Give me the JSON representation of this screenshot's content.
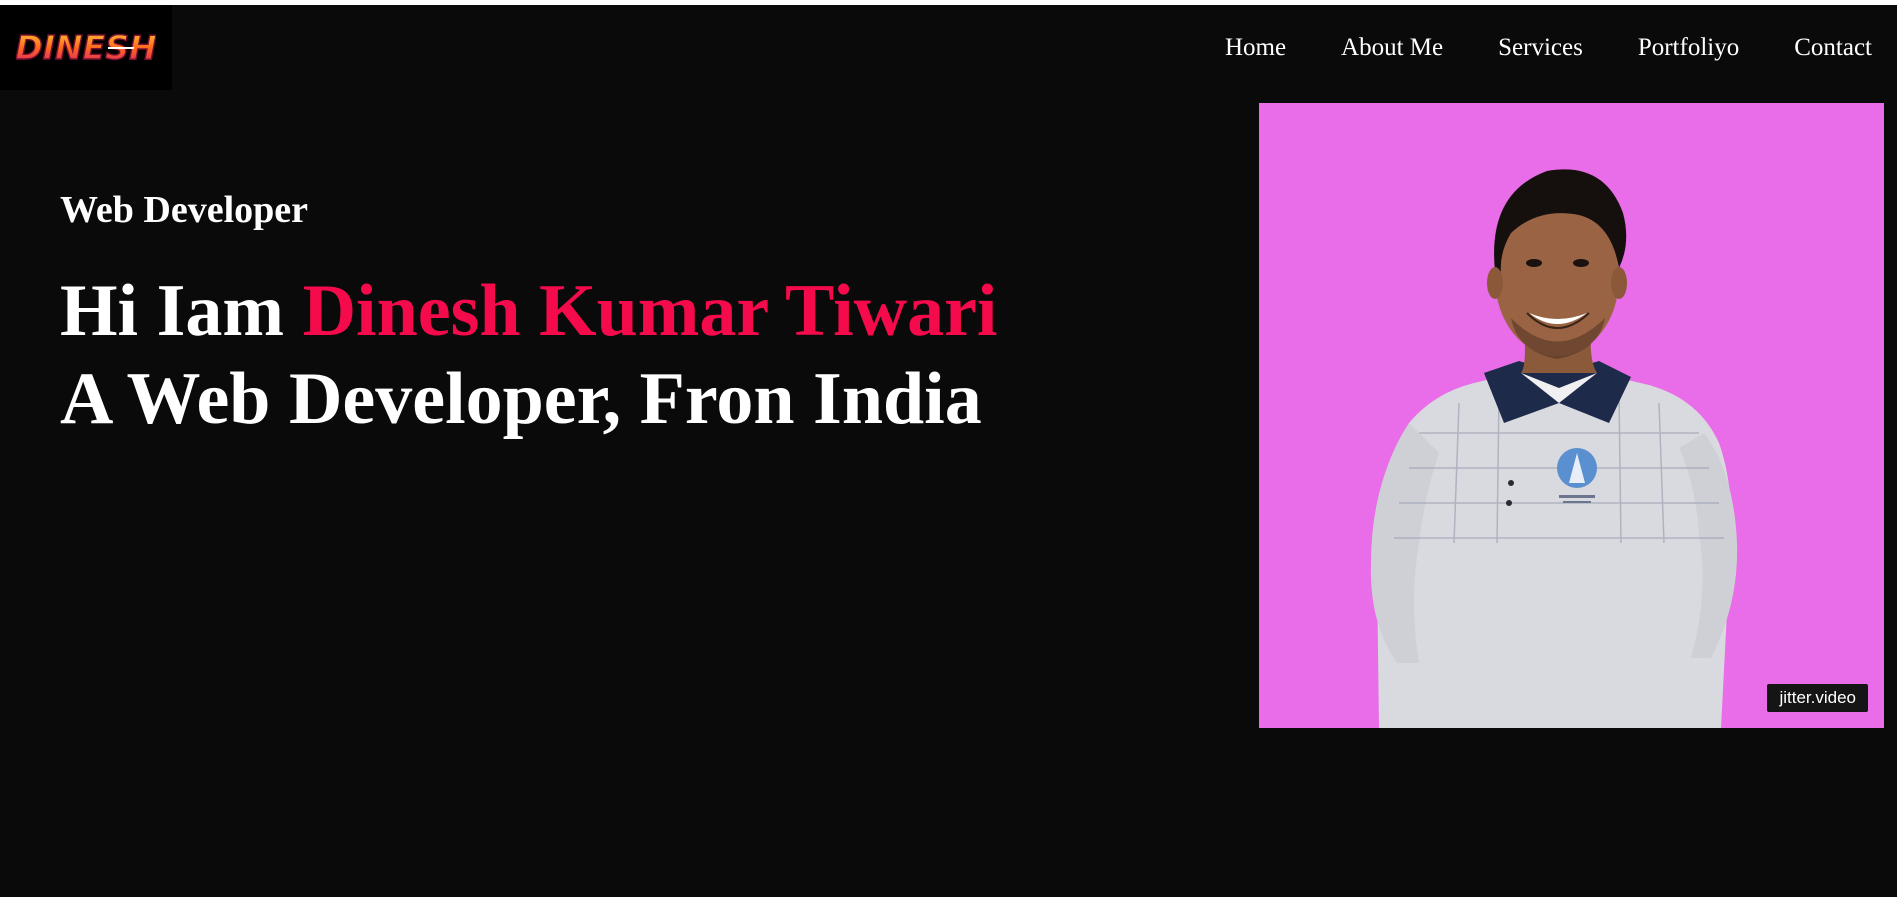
{
  "logo": {
    "text": "DINESH"
  },
  "nav": {
    "items": [
      "Home",
      "About Me",
      "Services",
      "Portfoliyo",
      "Contact"
    ]
  },
  "hero": {
    "subtitle": "Web Developer",
    "line1_prefix": "Hi Iam ",
    "line1_name": "Dinesh Kumar Tiwari",
    "line2": "A Web Developer, Fron India"
  },
  "photo": {
    "badge": "jitter.video"
  },
  "colors": {
    "background": "#0a0a0b",
    "accent": "#f50a4b",
    "photo_bg": "#e96ce9",
    "text": "#ffffff"
  }
}
